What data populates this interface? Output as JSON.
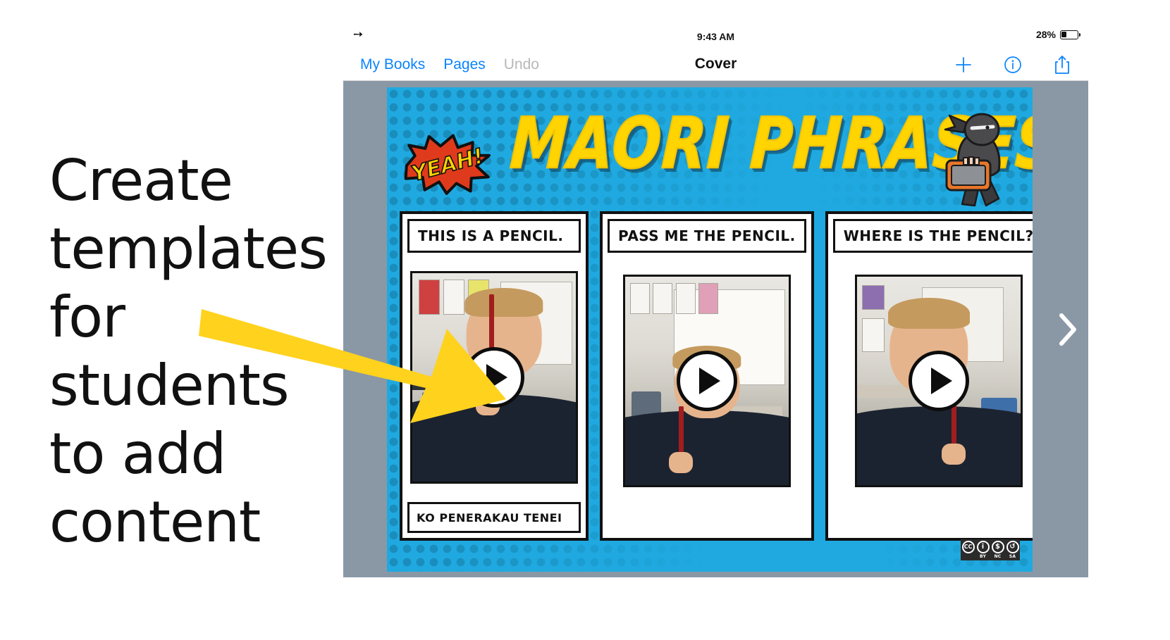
{
  "annotation": {
    "lines": [
      "Create",
      "templates",
      " for",
      "students",
      "to add",
      "content"
    ],
    "arrow_color": "#FFD21E",
    "arrow_name": "yellow-callout-arrow"
  },
  "status_bar": {
    "airplane_icon": "airplane-mode-icon",
    "time": "9:43 AM",
    "battery_percent_label": "28%",
    "battery_level": 28,
    "battery_icon": "battery-icon"
  },
  "nav_bar": {
    "my_books_label": "My Books",
    "pages_label": "Pages",
    "undo_label": "Undo",
    "title": "Cover",
    "add_icon": "plus-icon",
    "info_icon": "info-circle-icon",
    "share_icon": "share-icon",
    "tint_color": "#0a84ff",
    "disabled_color": "#b8b8b8"
  },
  "canvas": {
    "background_color": "#8a98a5",
    "next_page_icon": "chevron-right-icon"
  },
  "comic": {
    "background_color": "#1fa9e0",
    "title": "MAORI PHRASES",
    "title_color": "#ffd400",
    "burst_label": "YEAH!",
    "burst_fill": "#ffd400",
    "burst_outline": "#e03a1c",
    "character_icon": "ninja-with-tablet-icon",
    "panels": [
      {
        "caption_top": "THIS IS A PENCIL.",
        "caption_bottom": "KO PENERAKAU TENEI",
        "media_type": "video",
        "play_icon": "play-icon"
      },
      {
        "caption_top": "PASS ME THE PENCIL.",
        "caption_bottom": "",
        "media_type": "video",
        "play_icon": "play-icon"
      },
      {
        "caption_top": "WHERE IS THE PENCIL?",
        "caption_bottom": "",
        "media_type": "video",
        "play_icon": "play-icon"
      }
    ],
    "license": {
      "name": "creative-commons-by-nc-sa-badge",
      "cc_glyph": "CC",
      "by_glyph": "i",
      "nc_glyph": "$",
      "sa_glyph": "↺",
      "by_label": "BY",
      "nc_label": "NC",
      "sa_label": "SA"
    }
  }
}
